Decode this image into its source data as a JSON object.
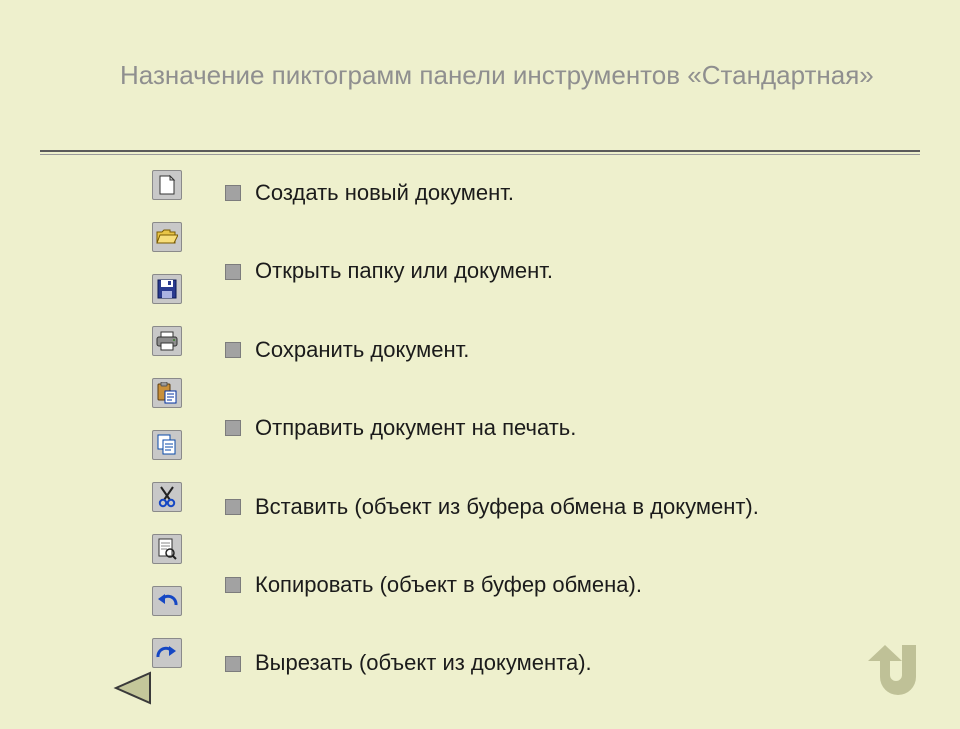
{
  "title": "Назначение пиктограмм панели инструментов «Стандартная»",
  "icons": [
    {
      "name": "new-file-icon"
    },
    {
      "name": "open-folder-icon"
    },
    {
      "name": "save-disk-icon"
    },
    {
      "name": "print-icon"
    },
    {
      "name": "paste-clipboard-icon"
    },
    {
      "name": "copy-icon"
    },
    {
      "name": "cut-scissors-icon"
    },
    {
      "name": "print-preview-icon"
    },
    {
      "name": "undo-icon"
    },
    {
      "name": "redo-icon"
    }
  ],
  "items": [
    {
      "text": "Создать новый документ."
    },
    {
      "text": "Открыть папку или документ."
    },
    {
      "text": "Сохранить документ."
    },
    {
      "text": "Отправить документ на печать."
    },
    {
      "text": "Вставить (объект из буфера обмена в документ)."
    },
    {
      "text": "Копировать (объект в буфер обмена)."
    },
    {
      "text": "Вырезать (объект из документа)."
    }
  ]
}
